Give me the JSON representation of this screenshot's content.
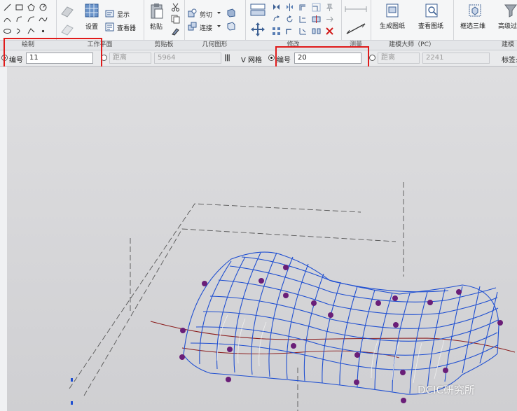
{
  "ribbon": {
    "panels": {
      "draw": "绘制",
      "workplane": "工作平面",
      "clipboard": "剪贴板",
      "geometry": "几何图形",
      "modify": "修改",
      "measure": "测量",
      "modeling_master": "建模大师（PC）",
      "modeling_master2": "建模"
    },
    "buttons": {
      "set": "设置",
      "show": "显示",
      "viewer": "查看器",
      "paste": "粘贴",
      "cut": "剪切",
      "join": "连接",
      "gen_sheet": "生成图纸",
      "view_sheet": "查看图纸",
      "box_3d": "框选三维",
      "advanced": "高级过"
    }
  },
  "options_bar": {
    "label_no_1": "编号",
    "value_no_1": "11",
    "label_dist_1": "距离",
    "value_dist_1": "5964",
    "v_grid": "V 网格",
    "label_no_2": "编号",
    "value_no_2": "20",
    "label_dist_2": "距离",
    "value_dist_2": "2241",
    "label_tag": "标签:"
  },
  "watermark": "DCIC研究所",
  "colors": {
    "highlight_box": "#e01b1b",
    "mesh": "#1f4fd1",
    "node": "#6a1e78",
    "curve": "#8a1a1a"
  }
}
